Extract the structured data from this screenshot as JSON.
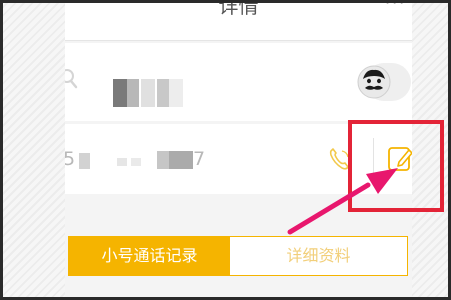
{
  "header": {
    "title": "详情",
    "more_glyph": "···"
  },
  "contact": {
    "avatar_icon": "mustache-face-icon"
  },
  "phone": {
    "number_prefix": "5",
    "number_suffix": "7",
    "call_icon": "phone-call-icon",
    "edit_icon": "edit-pencil-icon"
  },
  "tabs": [
    {
      "label": "小号通话记录",
      "active": true
    },
    {
      "label": "详细资料",
      "active": false
    }
  ],
  "colors": {
    "accent": "#f5b400",
    "annotation": "#e32437",
    "arrow": "#e8176d"
  }
}
